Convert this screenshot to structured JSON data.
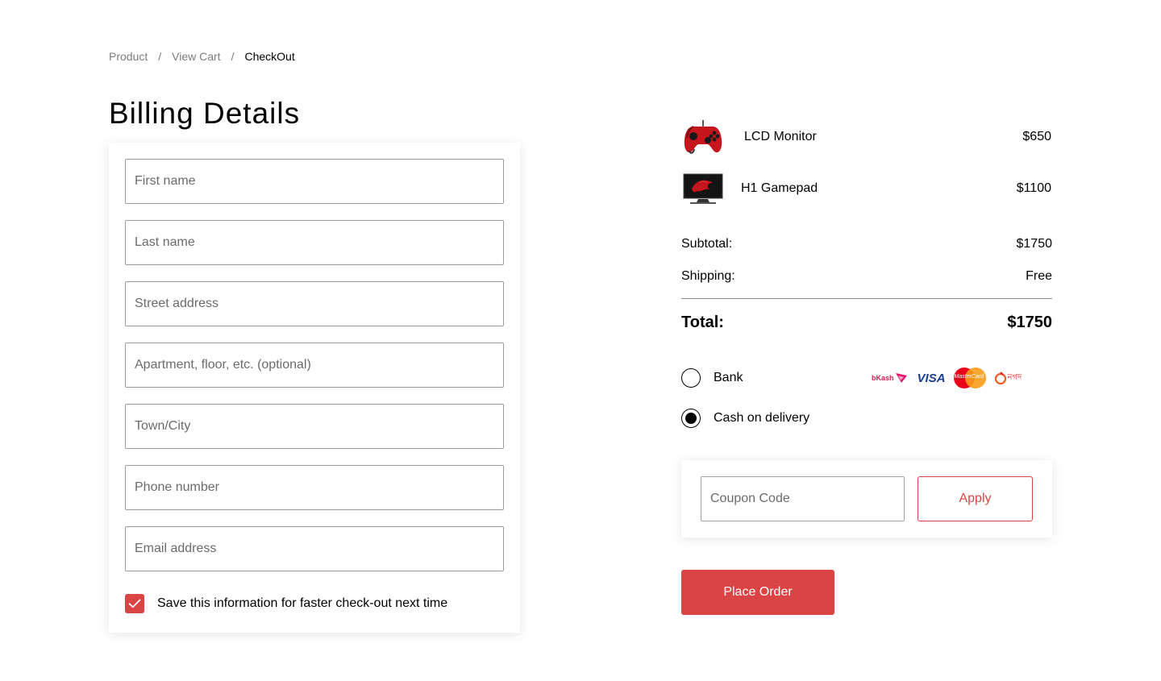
{
  "breadcrumb": {
    "items": [
      "Product",
      "View Cart"
    ],
    "separator": "/",
    "current": "CheckOut"
  },
  "billing": {
    "title": "Billing Details",
    "fields": {
      "first_name": "First name",
      "last_name": "Last name",
      "street_address": "Street address",
      "apartment": "Apartment, floor, etc. (optional)",
      "town_city": "Town/City",
      "phone": "Phone number",
      "email": "Email address"
    },
    "save_info": {
      "checked": true,
      "label": "Save this information for faster check-out next time"
    }
  },
  "order": {
    "items": [
      {
        "name": "LCD Monitor",
        "price": "$650",
        "icon": "gamepad-thumbnail"
      },
      {
        "name": "H1 Gamepad",
        "price": "$1100",
        "icon": "monitor-thumbnail"
      }
    ],
    "subtotal_label": "Subtotal:",
    "subtotal_value": "$1750",
    "shipping_label": "Shipping:",
    "shipping_value": "Free",
    "total_label": "Total:",
    "total_value": "$1750"
  },
  "payment": {
    "options": [
      {
        "label": "Bank",
        "selected": false
      },
      {
        "label": "Cash on delivery",
        "selected": true
      }
    ],
    "logos": {
      "bkash": "bKash",
      "visa": "VISA",
      "mastercard": "MasterCard",
      "nagad": "নগদ"
    }
  },
  "coupon": {
    "placeholder": "Coupon Code",
    "apply_label": "Apply"
  },
  "place_order_label": "Place Order",
  "colors": {
    "accent": "#DB4444",
    "text": "#000000",
    "muted": "#7D7D7D"
  }
}
